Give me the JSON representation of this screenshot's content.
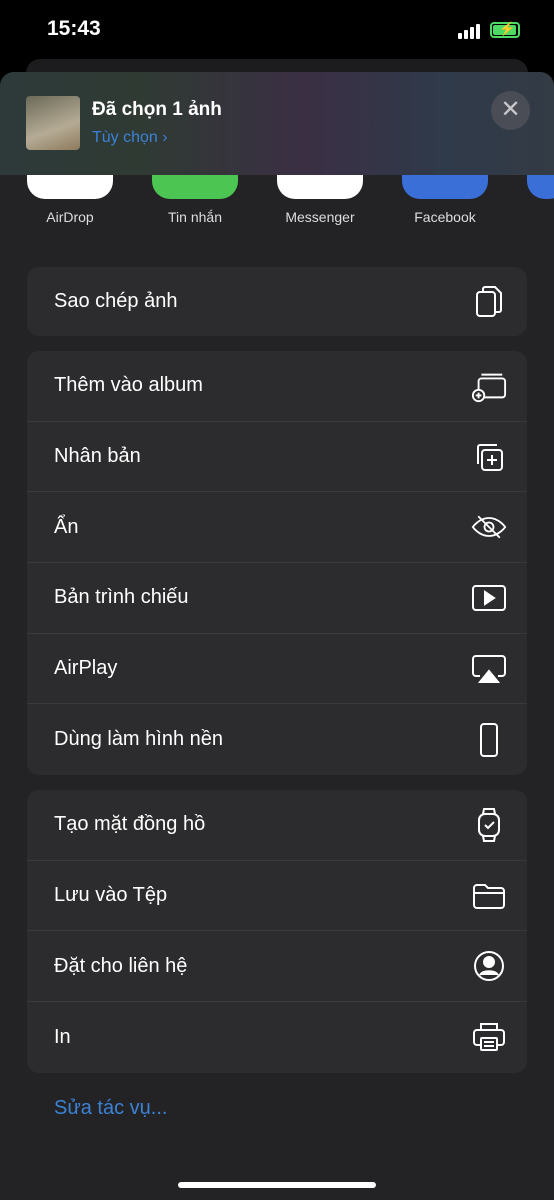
{
  "status": {
    "time": "15:43"
  },
  "header": {
    "title": "Đã chọn 1 ảnh",
    "options": "Tùy chọn ›",
    "close": "✕"
  },
  "apps": [
    {
      "label": "AirDrop",
      "color": "#ffffff"
    },
    {
      "label": "Tin nhắn",
      "color": "#4cc552"
    },
    {
      "label": "Messenger",
      "color": "#ffffff"
    },
    {
      "label": "Facebook",
      "color": "#3b6fd8"
    }
  ],
  "groups": [
    [
      {
        "label": "Sao chép ảnh",
        "icon": "copy-icon"
      }
    ],
    [
      {
        "label": "Thêm vào album",
        "icon": "add-to-album-icon"
      },
      {
        "label": "Nhân bản",
        "icon": "duplicate-icon"
      },
      {
        "label": "Ẩn",
        "icon": "eye-slash-icon"
      },
      {
        "label": "Bản trình chiếu",
        "icon": "play-rectangle-icon"
      },
      {
        "label": "AirPlay",
        "icon": "airplay-icon"
      },
      {
        "label": "Dùng làm hình nền",
        "icon": "iphone-icon"
      }
    ],
    [
      {
        "label": "Tạo mặt đồng hồ",
        "icon": "watch-icon"
      },
      {
        "label": "Lưu vào Tệp",
        "icon": "folder-icon"
      },
      {
        "label": "Đặt cho liên hệ",
        "icon": "person-circle-icon"
      },
      {
        "label": "In",
        "icon": "printer-icon"
      }
    ]
  ],
  "edit_actions": "Sửa tác vụ...",
  "accent": "#3b82d6"
}
